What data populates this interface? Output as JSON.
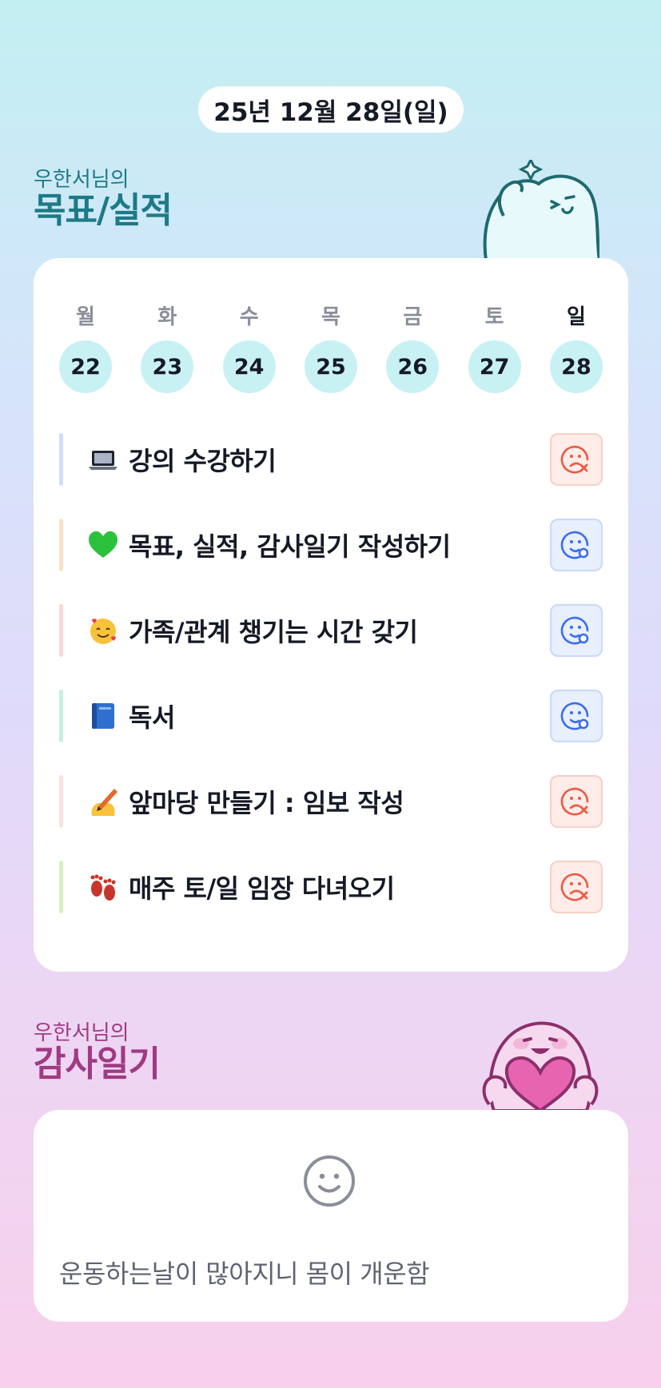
{
  "date": "25년 12월 28일(일)",
  "goals_section": {
    "sub": "우한서님의",
    "title": "목표/실적"
  },
  "week": {
    "days": [
      {
        "name": "월",
        "num": "22"
      },
      {
        "name": "화",
        "num": "23"
      },
      {
        "name": "수",
        "num": "24"
      },
      {
        "name": "목",
        "num": "25"
      },
      {
        "name": "금",
        "num": "26"
      },
      {
        "name": "토",
        "num": "27"
      },
      {
        "name": "일",
        "num": "28"
      }
    ],
    "selected_day": "일"
  },
  "goals": [
    {
      "label": "강의 수강하기",
      "icon": "laptop-icon",
      "bar_color": "#d3ddfb",
      "status": "fail"
    },
    {
      "label": "목표, 실적, 감사일기 작성하기",
      "icon": "green-heart-icon",
      "bar_color": "#fde1c4",
      "status": "ok"
    },
    {
      "label": "가족/관계 챙기는 시간 갖기",
      "icon": "smiling-face-with-hearts-icon",
      "bar_color": "#fcd6d6",
      "status": "ok"
    },
    {
      "label": "독서",
      "icon": "blue-book-icon",
      "bar_color": "#c4f0e4",
      "status": "ok"
    },
    {
      "label": "앞마당 만들기 : 임보 작성",
      "icon": "writing-hand-icon",
      "bar_color": "#fde1de",
      "status": "fail"
    },
    {
      "label": "매주 토/일 임장 다녀오기",
      "icon": "footprints-icon",
      "bar_color": "#d4f2bf",
      "status": "fail"
    }
  ],
  "thanks_section": {
    "sub": "우한서님의",
    "title": "감사일기"
  },
  "thanks_entry": {
    "text": "운동하는날이 많아지니 몸이 개운함",
    "icon": "smile-face-icon"
  },
  "colors": {
    "ok": "#3b6cf0",
    "fail": "#ea5a45",
    "goals_title": "#1d7a86",
    "thanks_title": "#a03a82"
  }
}
